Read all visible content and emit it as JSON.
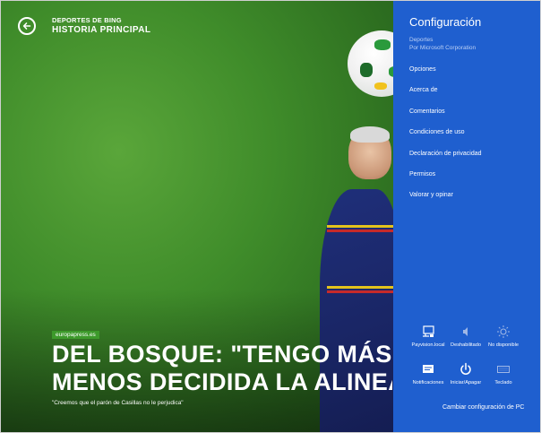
{
  "header": {
    "app_name": "DEPORTES DE BING",
    "section_title": "HISTORIA PRINCIPAL"
  },
  "article": {
    "source": "europapress.es",
    "headline_line1": "DEL BOSQUE: \"TENGO MÁS O",
    "headline_line2": "MENOS DECIDIDA LA ALINEAC",
    "quote": "\"Creemos que el parón de Casillas no le perjudica\""
  },
  "settings": {
    "title": "Configuración",
    "app": "Deportes",
    "publisher": "Por Microsoft Corporation",
    "items": [
      {
        "label": "Opciones"
      },
      {
        "label": "Acerca de"
      },
      {
        "label": "Comentarios"
      },
      {
        "label": "Condiciones de uso"
      },
      {
        "label": "Declaración de privacidad"
      },
      {
        "label": "Permisos"
      },
      {
        "label": "Valorar y opinar"
      }
    ],
    "quick": [
      {
        "label": "Payvision.local",
        "icon": "network-icon"
      },
      {
        "label": "Deshabilitado",
        "icon": "volume-icon"
      },
      {
        "label": "No disponible",
        "icon": "brightness-icon"
      },
      {
        "label": "Notificaciones",
        "icon": "notifications-icon"
      },
      {
        "label": "Iniciar/Apagar",
        "icon": "power-icon"
      },
      {
        "label": "Teclado",
        "icon": "keyboard-icon"
      }
    ],
    "change_pc": "Cambiar configuración de PC"
  },
  "colors": {
    "pane": "#1f5fcf",
    "badge": "#3d9a2b",
    "pitch": "#3f8c2a"
  }
}
